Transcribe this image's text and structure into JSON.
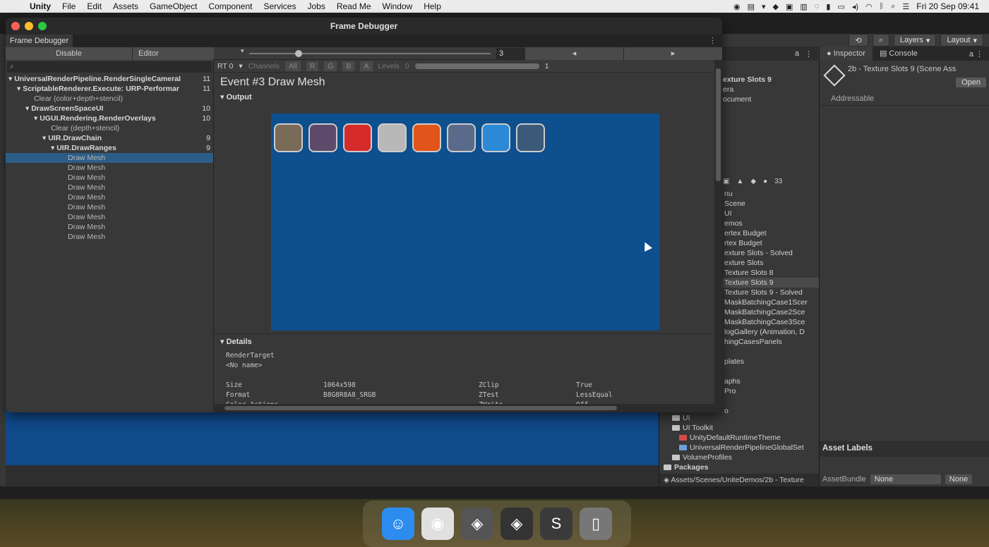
{
  "menubar": {
    "app": "Unity",
    "items": [
      "File",
      "Edit",
      "Assets",
      "GameObject",
      "Component",
      "Services",
      "Jobs",
      "Read Me",
      "Window",
      "Help"
    ],
    "clock": "Fri 20 Sep  09:41"
  },
  "toolbar": {
    "layers": "Layers",
    "layout": "Layout"
  },
  "frame_debugger": {
    "title": "Frame Debugger",
    "tab": "Frame Debugger",
    "disable": "Disable",
    "target": "Editor",
    "frame_value": "3",
    "prev": "◂",
    "next": "▸",
    "search_icon": "⌕",
    "tree": [
      {
        "label": "UniversalRenderPipeline.RenderSingleCameraI",
        "count": "11",
        "indent": 0,
        "bold": true
      },
      {
        "label": "ScriptableRenderer.Execute: URP-Performar",
        "count": "11",
        "indent": 1,
        "bold": true
      },
      {
        "label": "Clear (color+depth+stencil)",
        "count": "",
        "indent": 3,
        "bold": false
      },
      {
        "label": "DrawScreenSpaceUI",
        "count": "10",
        "indent": 2,
        "bold": true
      },
      {
        "label": "UGUI.Rendering.RenderOverlays",
        "count": "10",
        "indent": 3,
        "bold": true
      },
      {
        "label": "Clear (depth+stencil)",
        "count": "",
        "indent": 5,
        "bold": false
      },
      {
        "label": "UIR.DrawChain",
        "count": "9",
        "indent": 4,
        "bold": true
      },
      {
        "label": "UIR.DrawRanges",
        "count": "9",
        "indent": 5,
        "bold": true
      },
      {
        "label": "Draw Mesh",
        "count": "",
        "indent": 7,
        "bold": false,
        "selected": true
      },
      {
        "label": "Draw Mesh",
        "count": "",
        "indent": 7,
        "bold": false
      },
      {
        "label": "Draw Mesh",
        "count": "",
        "indent": 7,
        "bold": false
      },
      {
        "label": "Draw Mesh",
        "count": "",
        "indent": 7,
        "bold": false
      },
      {
        "label": "Draw Mesh",
        "count": "",
        "indent": 7,
        "bold": false
      },
      {
        "label": "Draw Mesh",
        "count": "",
        "indent": 7,
        "bold": false
      },
      {
        "label": "Draw Mesh",
        "count": "",
        "indent": 7,
        "bold": false
      },
      {
        "label": "Draw Mesh",
        "count": "",
        "indent": 7,
        "bold": false
      },
      {
        "label": "Draw Mesh",
        "count": "",
        "indent": 7,
        "bold": false
      }
    ],
    "rt": {
      "target": "RT 0",
      "channels_label": "Channels",
      "channels": [
        "All",
        "R",
        "G",
        "B",
        "A"
      ],
      "levels_label": "Levels",
      "levels_min": "0",
      "levels_max": "1"
    },
    "event_title": "Event #3 Draw Mesh",
    "output_header": "Output",
    "thumb_colors": [
      "#7a6a58",
      "#5d4a6b",
      "#d62b2b",
      "#b8b8b8",
      "#e2551a",
      "#5a6a8a",
      "#2a8ad6",
      "#3b5a7a"
    ],
    "details_header": "Details",
    "render_target_label": "RenderTarget",
    "render_target_value": "<No name>",
    "details_left": [
      {
        "key": "Size",
        "value": "1064x598"
      },
      {
        "key": "Format",
        "value": "B8G8R8A8_SRGB"
      },
      {
        "key": "Color Actions",
        "value": "-"
      }
    ],
    "details_right": [
      {
        "key": "ZClip",
        "value": "True"
      },
      {
        "key": "ZTest",
        "value": "LessEqual"
      },
      {
        "key": "ZWrite",
        "value": "Off"
      }
    ]
  },
  "project": {
    "items": [
      {
        "label": "exture Slots 9",
        "sel": false
      },
      {
        "label": "era",
        "sel": false
      },
      {
        "label": "ocument",
        "sel": false
      }
    ],
    "list": [
      {
        "label": "nu",
        "sel": false
      },
      {
        "label": "Scene",
        "sel": false
      },
      {
        "label": "UI",
        "sel": false
      },
      {
        "label": "emos",
        "sel": false
      },
      {
        "label": "ertex Budget",
        "sel": false
      },
      {
        "label": "rtex Budget",
        "sel": false
      },
      {
        "label": "exture Slots - Solved",
        "sel": false
      },
      {
        "label": "exture Slots",
        "sel": false
      },
      {
        "label": "Texture Slots 8",
        "sel": false
      },
      {
        "label": "Texture Slots 9",
        "sel": true
      },
      {
        "label": "Texture Slots 9 - Solved",
        "sel": false
      },
      {
        "label": "MaskBatchingCase1Scer",
        "sel": false
      },
      {
        "label": "MaskBatchingCase2Sce",
        "sel": false
      },
      {
        "label": "MaskBatchingCase3Sce",
        "sel": false
      },
      {
        "label": "logGallery (Animation, D",
        "sel": false
      },
      {
        "label": "hingCasesPanels",
        "sel": false
      },
      {
        "label": "",
        "sel": false
      },
      {
        "label": "plates",
        "sel": false
      },
      {
        "label": "",
        "sel": false
      },
      {
        "label": "aphs",
        "sel": false
      },
      {
        "label": "Pro",
        "sel": false
      },
      {
        "label": "",
        "sel": false
      },
      {
        "label": "o",
        "sel": false
      }
    ],
    "tree": [
      "UI",
      "UI Toolkit",
      "UnityDefaultRuntimeTheme",
      "UniversalRenderPipelineGlobalSet",
      "VolumeProfiles",
      "Packages"
    ],
    "count": "33",
    "path": "Assets/Scenes/UniteDemos/2b - Texture"
  },
  "inspector": {
    "tabs": [
      "Inspector",
      "Console"
    ],
    "title": "2b - Texture Slots 9 (Scene Ass",
    "open": "Open",
    "addressable": "Addressable",
    "asset_labels": "Asset Labels",
    "assetbundle_label": "AssetBundle",
    "assetbundle_value": "None",
    "variant_value": "None"
  },
  "dock": [
    {
      "name": "finder-icon",
      "color": "#2d8cf0",
      "glyph": "☺"
    },
    {
      "name": "chrome-icon",
      "color": "#e0e0e0",
      "glyph": "◉"
    },
    {
      "name": "unity-hub-icon",
      "color": "#555",
      "glyph": "◈"
    },
    {
      "name": "unity-icon",
      "color": "#333",
      "glyph": "◈"
    },
    {
      "name": "sublime-icon",
      "color": "#3a3a3a",
      "glyph": "S"
    },
    {
      "name": "trash-icon",
      "color": "#777",
      "glyph": "▯"
    }
  ]
}
